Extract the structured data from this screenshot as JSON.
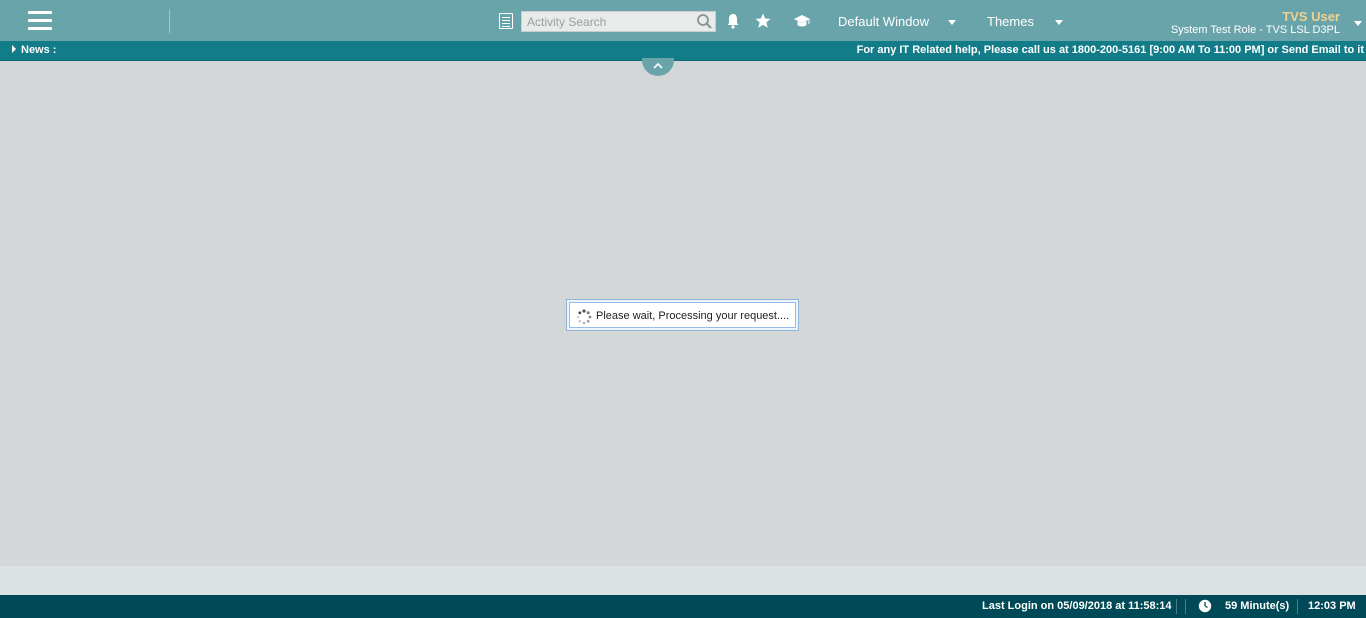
{
  "topbar": {
    "search_placeholder": "Activity Search",
    "default_window_label": "Default Window",
    "themes_label": "Themes",
    "user_name": "TVS User",
    "user_role": "System Test Role - TVS LSL D3PL"
  },
  "news": {
    "label": "News :",
    "ticker": "For any IT Related help, Please call us at 1800-200-5161 [9:00 AM To 11:00 PM] or Send Email to it"
  },
  "loading": {
    "message": "Please wait, Processing your request...."
  },
  "footer": {
    "last_login": "Last Login on 05/09/2018 at 11:58:14",
    "session_time": "59 Minute(s)",
    "clock_time": "12:03 PM"
  },
  "colors": {
    "header": "#6aa4ab",
    "newsbar": "#127c89",
    "footer": "#004a57",
    "username": "#f1d28a",
    "content_bg": "#d3d7d8"
  },
  "icons": [
    "menu-icon",
    "activity-list-icon",
    "search-icon",
    "bell-icon",
    "star-icon",
    "graduation-cap-icon",
    "chevron-up-icon",
    "spinner-icon",
    "clock-icon"
  ]
}
